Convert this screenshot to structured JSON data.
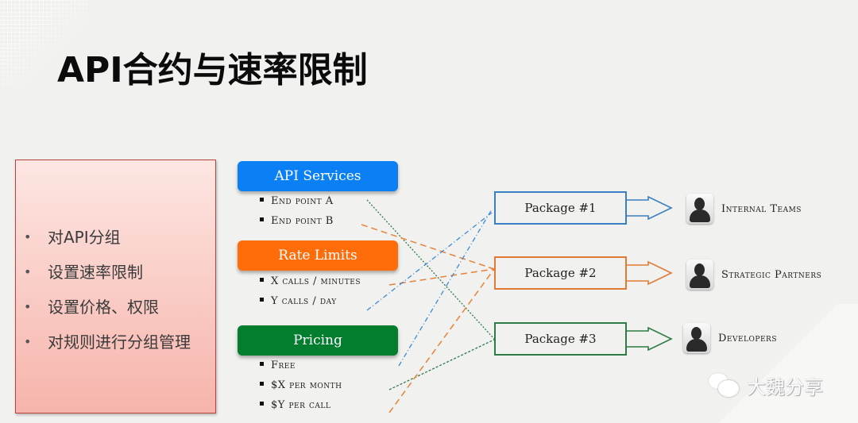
{
  "title": "API合约与速率限制",
  "left_box": {
    "items": [
      "对API分组",
      "设置速率限制",
      "设置价格、权限",
      "对规则进行分组管理"
    ]
  },
  "categories": [
    {
      "id": "api",
      "label": "API Services",
      "color": "#0b80f5",
      "items": [
        "End point A",
        "End point B"
      ]
    },
    {
      "id": "rate",
      "label": "Rate Limits",
      "color": "#ff6c0a",
      "items": [
        "X calls / minutes",
        "Y calls / day"
      ]
    },
    {
      "id": "pricing",
      "label": "Pricing",
      "color": "#037e2f",
      "items": [
        "Free",
        "$X per month",
        "$Y per call"
      ]
    }
  ],
  "packages": [
    {
      "label": "Package #1",
      "color": "#3a7fc1"
    },
    {
      "label": "Package #2",
      "color": "#e07a35"
    },
    {
      "label": "Package #3",
      "color": "#2d7c47"
    }
  ],
  "audiences": [
    {
      "label": "Internal Teams",
      "icon": "user-avatar-icon"
    },
    {
      "label": "Strategic Partners",
      "icon": "user-avatar-icon"
    },
    {
      "label": "Developers",
      "icon": "user-avatar-icon"
    }
  ],
  "connections": [
    {
      "from": "End point A",
      "to": "Package #3",
      "style": "green-dotted"
    },
    {
      "from": "End point B",
      "to": "Package #2",
      "style": "orange-dashed"
    },
    {
      "from": "X calls / minutes",
      "to": "Package #2",
      "style": "orange-dashed"
    },
    {
      "from": "Y calls / day",
      "to": "Package #1",
      "style": "blue-dashdot"
    },
    {
      "from": "$X per month",
      "to": "Package #3",
      "style": "green-dotted"
    },
    {
      "from": "$Y per call",
      "to": "Package #2",
      "style": "orange-dashed"
    },
    {
      "from": "Pricing (upper)",
      "to": "Package #1",
      "style": "blue-dashdot"
    }
  ],
  "watermark": {
    "icon": "wechat-icon",
    "text": "大魏分享"
  }
}
